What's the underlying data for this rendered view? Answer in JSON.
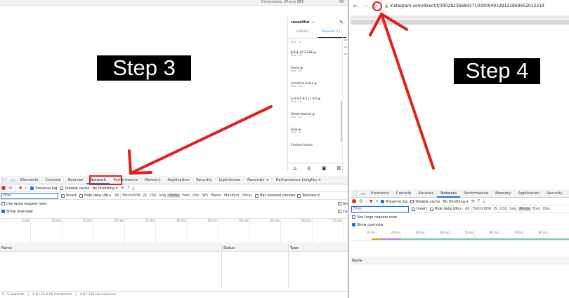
{
  "left": {
    "dims_label": "Dimensions: iPhone SE",
    "dims_w": "375",
    "dims_zoom": "66",
    "step_label": "Step 3",
    "instagram": {
      "username": "russellful",
      "chevron": "⌵",
      "tabs": [
        "GENERAL",
        "Requests (11)"
      ],
      "threads": [
        {
          "name": "",
          "sub": "Text · 2w"
        },
        {
          "name": "JESSE JO STARK",
          "sub": "Text · 2w"
        },
        {
          "name": "Seven",
          "sub": "Text · 2w"
        },
        {
          "name": "Anastasia Soare",
          "sub": "Text · 2w"
        },
        {
          "name": "A N N A H E L I N A",
          "sub": "Text · 2w"
        },
        {
          "name": "Shiden Kaslani",
          "sub": "Text · 2w"
        },
        {
          "name": "Kylie",
          "sub": "Text · 2w"
        },
        {
          "name": "Chelsea Ashton",
          "sub": ""
        }
      ],
      "verified": "●",
      "nav_icons": [
        "⌂",
        "◎",
        "▣",
        "⊞"
      ]
    },
    "devtools": {
      "tabs": [
        "Elements",
        "Console",
        "Sources",
        "Network",
        "Performance",
        "Memory",
        "Application",
        "Security",
        "Lighthouse",
        "Recorder ⏶",
        "Performance insights ⏶"
      ],
      "active_tab": "Network",
      "preserve_log": "Preserve log",
      "disable_cache": "Disable cache",
      "throttling": "No throttling",
      "filter_placeholder": "Filter",
      "invert": "Invert",
      "hide_data_urls": "Hide data URLs",
      "filter_types": [
        "All",
        "Fetch/XHR",
        "JS",
        "CSS",
        "Img",
        "Media",
        "Font",
        "Doc",
        "WS",
        "Wasm",
        "Manifest",
        "Other"
      ],
      "active_type": "Media",
      "has_blocked_cookies": "Has blocked cookies",
      "blocked": "Blocked R",
      "large_rows": "Use large request rows",
      "show_overview": "Show overview",
      "group_label": "Gro",
      "capture_label": "Ca",
      "ticks": [
        "5 ms",
        "10 ms",
        "15 ms",
        "20 ms",
        "25 ms",
        "30 ms",
        "35 ms",
        "40 ms",
        "45 ms",
        "50 ms",
        "55 ms"
      ],
      "columns": [
        "Name",
        "Status",
        "Type"
      ],
      "status": [
        "0 / 5 requests",
        "0 B / 16.0 kB transferred",
        "0 B / 126 kB resources"
      ]
    }
  },
  "right": {
    "url": "instagram.com/direct/t/340282366841710300949128121869652012219",
    "step_label": "Step 4",
    "devtools": {
      "tabs": [
        "Elements",
        "Console",
        "Sources",
        "Network",
        "Performance",
        "Memory",
        "Application",
        "Security"
      ],
      "active_tab": "Network",
      "preserve_log": "Preserve log",
      "disable_cache": "Disable cache",
      "throttling": "No throttling",
      "filter_placeholder": "Filter",
      "invert": "Invert",
      "hide_data_urls": "Hide data URLs",
      "filter_types": [
        "All",
        "Fetch/XHR",
        "JS",
        "CSS",
        "Img",
        "Media",
        "Font",
        "Doc"
      ],
      "active_type": "Media",
      "large_rows": "Use large request rows",
      "show_overview": "Show overview",
      "ticks": [
        "10 ms",
        "20 ms",
        "30 ms",
        "40 ms",
        "50 ms",
        "60 ms",
        "70 ms",
        "80 ms"
      ],
      "name_col": "Name"
    }
  },
  "colors": {
    "annotation_red": "#e0201b",
    "devtools_blue": "#1a73e8",
    "record_red": "#d93025"
  },
  "icons": {
    "back": "←",
    "forward": "→",
    "reload": "↻",
    "lock": "🔒",
    "record": "●",
    "clear": "⊘",
    "funnel": "▼",
    "search": "⌕",
    "wifi": "≋",
    "upload": "⤒",
    "download": "⤓",
    "device": "▭",
    "inspect": "⬚",
    "edit": "✎",
    "dropdown": "▾"
  }
}
